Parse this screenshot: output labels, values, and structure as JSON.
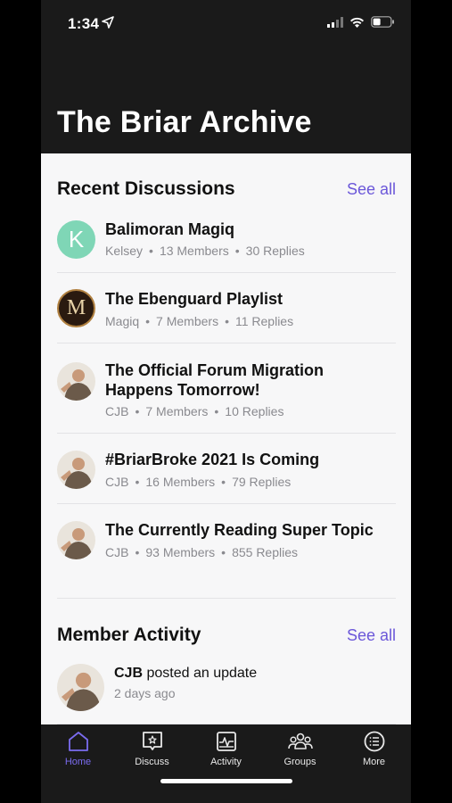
{
  "status_bar": {
    "time": "1:34"
  },
  "header": {
    "title": "The Briar Archive"
  },
  "recent_discussions": {
    "title": "Recent Discussions",
    "see_all": "See all",
    "items": [
      {
        "title": "Balimoran Magiq",
        "author": "Kelsey",
        "members": "13 Members",
        "replies": "30 Replies",
        "avatar": "letter",
        "avatar_letter": "K"
      },
      {
        "title": "The Ebenguard Playlist",
        "author": "Magiq",
        "members": "7 Members",
        "replies": "11 Replies",
        "avatar": "monogram",
        "avatar_letter": "M"
      },
      {
        "title": "The Official Forum Migration Happens Tomorrow!",
        "author": "CJB",
        "members": "7 Members",
        "replies": "10 Replies",
        "avatar": "photo"
      },
      {
        "title": "#BriarBroke 2021 Is Coming",
        "author": "CJB",
        "members": "16 Members",
        "replies": "79 Replies",
        "avatar": "photo"
      },
      {
        "title": "The Currently Reading Super Topic",
        "author": "CJB",
        "members": "93 Members",
        "replies": "855 Replies",
        "avatar": "photo"
      }
    ]
  },
  "member_activity": {
    "title": "Member Activity",
    "see_all": "See all",
    "items": [
      {
        "user": "CJB",
        "action": " posted an update",
        "time": "2 days ago"
      }
    ]
  },
  "tabs": [
    {
      "label": "Home",
      "icon": "home-icon",
      "active": true
    },
    {
      "label": "Discuss",
      "icon": "discuss-icon",
      "active": false
    },
    {
      "label": "Activity",
      "icon": "activity-icon",
      "active": false
    },
    {
      "label": "Groups",
      "icon": "groups-icon",
      "active": false
    },
    {
      "label": "More",
      "icon": "more-icon",
      "active": false
    }
  ],
  "colors": {
    "accent": "#6b57d9",
    "tab_active": "#7b6cf0",
    "header_bg": "#1a1a1a",
    "content_bg": "#f7f7f8",
    "avatar_k": "#7fd6b6"
  }
}
